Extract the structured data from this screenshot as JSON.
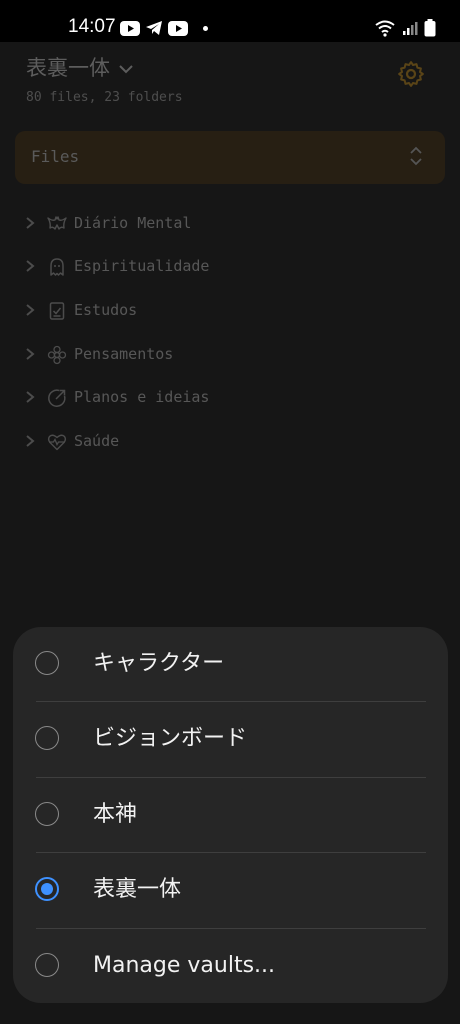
{
  "status_bar": {
    "time": "14:07",
    "left_icons": [
      "youtube-icon",
      "telegram-icon",
      "youtube-icon",
      "dot-icon"
    ],
    "right_icons": [
      "wifi-icon",
      "signal-icon",
      "battery-icon"
    ]
  },
  "vault": {
    "name": "表裏一体",
    "stats": "80 files, 23 folders"
  },
  "files_select": {
    "label": "Files"
  },
  "folders": [
    {
      "label": "Diário Mental",
      "icon": "bat-icon"
    },
    {
      "label": "Espiritualidade",
      "icon": "ghost-icon"
    },
    {
      "label": "Estudos",
      "icon": "clipboard-check-icon"
    },
    {
      "label": "Pensamentos",
      "icon": "flower-icon"
    },
    {
      "label": "Planos e ideias",
      "icon": "external-link-circle-icon"
    },
    {
      "label": "Saúde",
      "icon": "heart-pulse-icon"
    }
  ],
  "vault_sheet": {
    "options": [
      {
        "label": "キャラクター",
        "selected": false
      },
      {
        "label": "ビジョンボード",
        "selected": false
      },
      {
        "label": "本神",
        "selected": false
      },
      {
        "label": "表裏一体",
        "selected": true
      },
      {
        "label": "Manage vaults...",
        "selected": false
      }
    ]
  },
  "colors": {
    "accent": "#3e91ff",
    "sheet_background": "#262626",
    "app_background": "#161616",
    "select_background": "#271f13"
  }
}
